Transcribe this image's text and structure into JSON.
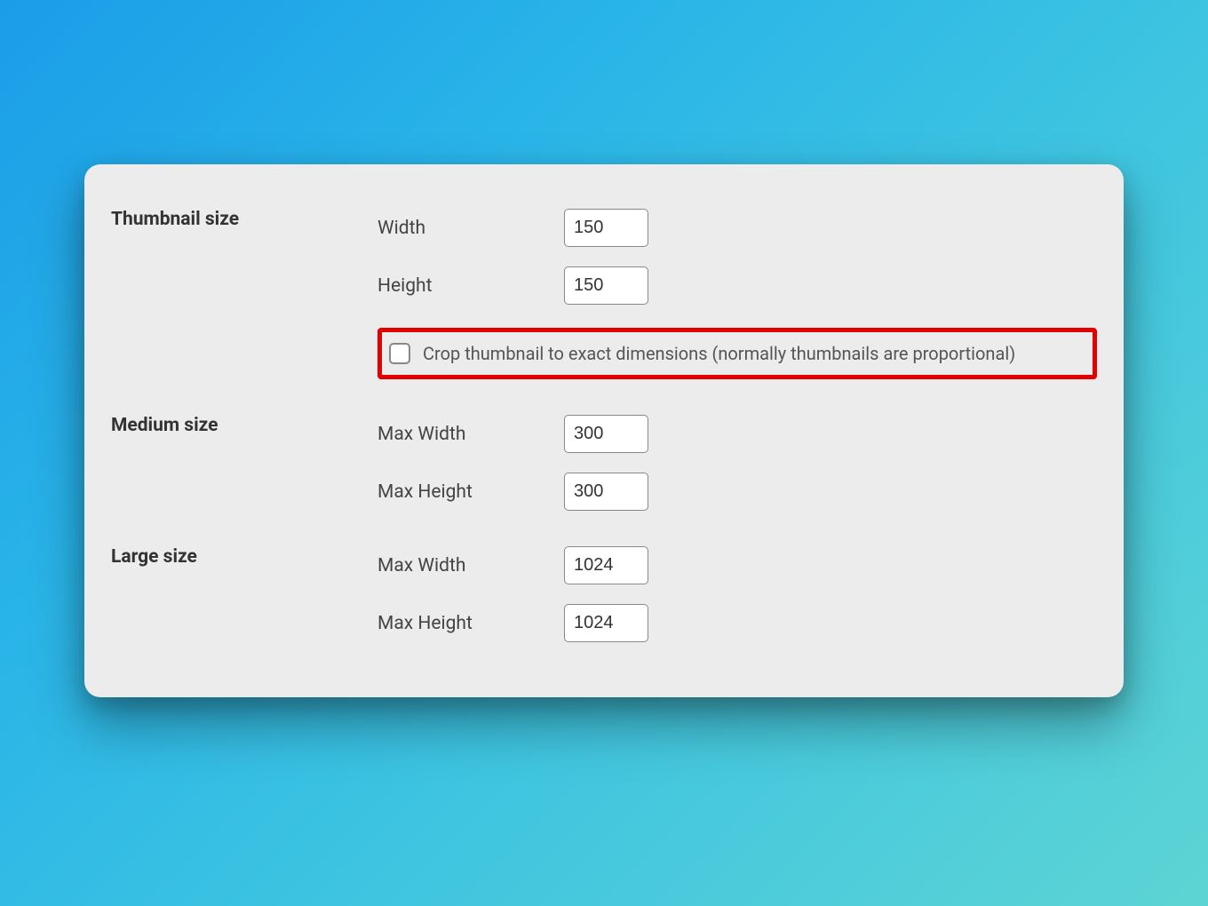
{
  "sections": {
    "thumbnail": {
      "title": "Thumbnail size",
      "width_label": "Width",
      "width_value": "150",
      "height_label": "Height",
      "height_value": "150",
      "crop_label": "Crop thumbnail to exact dimensions (normally thumbnails are proportional)"
    },
    "medium": {
      "title": "Medium size",
      "maxwidth_label": "Max Width",
      "maxwidth_value": "300",
      "maxheight_label": "Max Height",
      "maxheight_value": "300"
    },
    "large": {
      "title": "Large size",
      "maxwidth_label": "Max Width",
      "maxwidth_value": "1024",
      "maxheight_label": "Max Height",
      "maxheight_value": "1024"
    }
  }
}
